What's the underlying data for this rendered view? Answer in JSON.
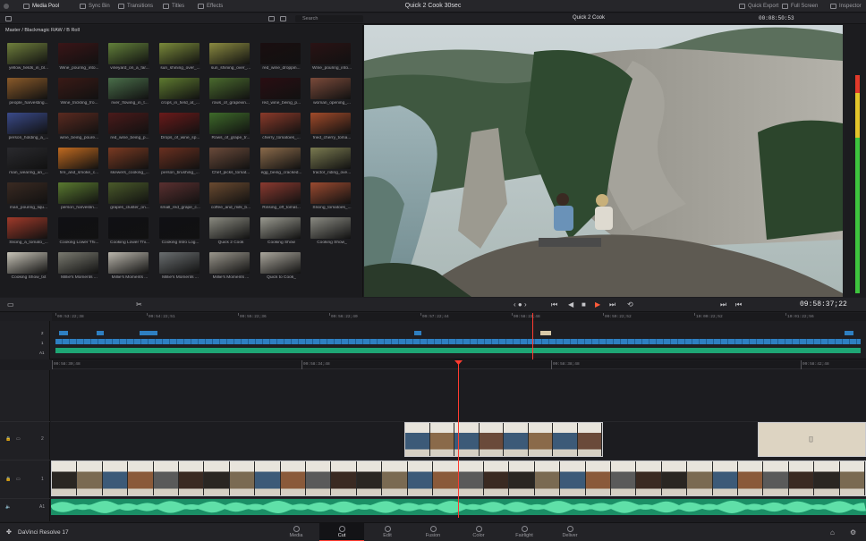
{
  "window": {
    "title": "Quick 2 Cook 30sec"
  },
  "toolbar": {
    "media_pool": "Media Pool",
    "sync_bin": "Sync Bin",
    "transitions": "Transitions",
    "titles": "Titles",
    "effects": "Effects",
    "quick_export": "Quick Export",
    "full_screen": "Full Screen",
    "inspector": "Inspector"
  },
  "subbar": {
    "search_placeholder": "Search",
    "viewer_name": "Quick 2 Cook",
    "timecode": "00:08:50:53"
  },
  "media_pool": {
    "path": "Master / Blackmagic RAW / B Roll",
    "clips": [
      {
        "label": "yellow_fields_in_bl...",
        "color": "#6f7f3c"
      },
      {
        "label": "Wine_pouring_into...",
        "color": "#3a1517"
      },
      {
        "label": "vineyard_on_a_far...",
        "color": "#62803a"
      },
      {
        "label": "sun_shining_over_...",
        "color": "#7a8a3a"
      },
      {
        "label": "sun_shining_over_...",
        "color": "#8a8a40"
      },
      {
        "label": "red_wine_droppin...",
        "color": "#1a0e10"
      },
      {
        "label": "Wine_pouring_into...",
        "color": "#2a1214"
      },
      {
        "label": "people_harvesting...",
        "color": "#8a5a2a"
      },
      {
        "label": "Wine_trickling_fro...",
        "color": "#3a1a16"
      },
      {
        "label": "river_flowing_in_t...",
        "color": "#4a6e4a"
      },
      {
        "label": "crops_in_field_at_...",
        "color": "#5e7a30"
      },
      {
        "label": "rows_of_grapevin...",
        "color": "#4a6a2e"
      },
      {
        "label": "red_wine_being_p...",
        "color": "#2a0e12"
      },
      {
        "label": "woman_opening_...",
        "color": "#7a4a3a"
      },
      {
        "label": "person_holding_a_...",
        "color": "#3a4a8a"
      },
      {
        "label": "wine_being_poure...",
        "color": "#5a2a20"
      },
      {
        "label": "red_wine_being_p...",
        "color": "#4a1a1a"
      },
      {
        "label": "Drops_of_wine_sp...",
        "color": "#6a1a1a"
      },
      {
        "label": "Rows_of_grape_tr...",
        "color": "#3e6a2a"
      },
      {
        "label": "cherry_tomatoes_...",
        "color": "#8a3a2a"
      },
      {
        "label": "fried_cherry_toma...",
        "color": "#a04a2a"
      },
      {
        "label": "man_wearing_an_...",
        "color": "#2a2a2e"
      },
      {
        "label": "fire_and_smoke_c...",
        "color": "#c06a20"
      },
      {
        "label": "skewers_cooking_...",
        "color": "#7a3a22"
      },
      {
        "label": "person_brushing_...",
        "color": "#6a3020"
      },
      {
        "label": "Chef_picks_tomat...",
        "color": "#6a4a3a"
      },
      {
        "label": "egg_being_cracked...",
        "color": "#8a6a4a"
      },
      {
        "label": "tractor_riding_ove...",
        "color": "#7a7a50"
      },
      {
        "label": "man_pouring_liqu...",
        "color": "#3a2a22"
      },
      {
        "label": "person_harvestin...",
        "color": "#5a7a30"
      },
      {
        "label": "grapes_cluster_on...",
        "color": "#4a5a2a"
      },
      {
        "label": "small_red_grape_c...",
        "color": "#5a3030"
      },
      {
        "label": "coffee_and_milk_b...",
        "color": "#6a4a30"
      },
      {
        "label": "Rinsing_off_tomat...",
        "color": "#8a3a30"
      },
      {
        "label": "Slicing_tomatoes_...",
        "color": "#9a4a30"
      },
      {
        "label": "Slicing_a_tomato_...",
        "color": "#a03a2a"
      },
      {
        "label": "Cooking Lower Thi...",
        "color": "#101014"
      },
      {
        "label": "Cooking Lower Thi...",
        "color": "#101014"
      },
      {
        "label": "Cooking Intro Log...",
        "color": "#101014"
      },
      {
        "label": "Quick 2 Cook",
        "color": "#8a8a80"
      },
      {
        "label": "Cooking Show",
        "color": "#9a9a90"
      },
      {
        "label": "Cooking Show_",
        "color": "#8a8a82"
      },
      {
        "label": "Cooking Show_txt",
        "color": "#c8c4b8"
      },
      {
        "label": "Millie's Moments ...",
        "color": "#7a7a70"
      },
      {
        "label": "Millie's Moments ...",
        "color": "#bab6ac"
      },
      {
        "label": "Millie's Moments ...",
        "color": "#6a6e70"
      },
      {
        "label": "Millie's Moments ...",
        "color": "#9a968c"
      },
      {
        "label": "Quick to Cook_",
        "color": "#aaa69c"
      }
    ]
  },
  "transport": {
    "timecode": "09:58:37;22"
  },
  "upper_timeline": {
    "ticks": [
      "09:53:22;38",
      "09:54:22;51",
      "09:55:22;36",
      "09:56:22;40",
      "09:57:22;44",
      "09:58:22;48",
      "09:59:22;52",
      "10:00:22;52",
      "10:01:22;56"
    ],
    "tracks": [
      "2",
      "1",
      "A1"
    ]
  },
  "lower_timeline": {
    "ticks": [
      "09:58:30;48",
      "09:58:34;48",
      "09:58:38;48",
      "09:58:42;48"
    ],
    "tracks": [
      "2",
      "1",
      "A1"
    ]
  },
  "pages": [
    "Media",
    "Cut",
    "Edit",
    "Fusion",
    "Color",
    "Fairlight",
    "Deliver"
  ],
  "app_name": "DaVinci Resolve 17"
}
